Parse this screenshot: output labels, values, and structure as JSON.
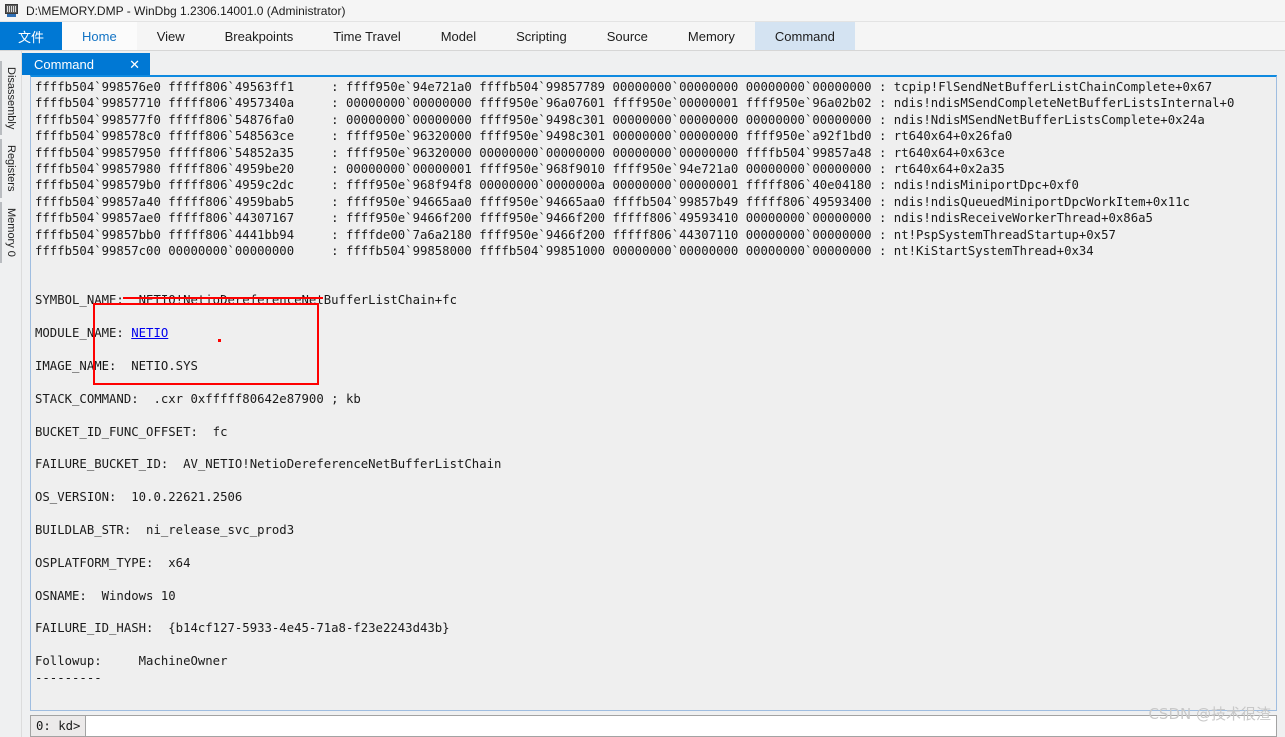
{
  "window": {
    "title": "D:\\MEMORY.DMP - WinDbg 1.2306.14001.0 (Administrator)",
    "icon": "windbg-app-icon"
  },
  "ribbon": {
    "file_label": "文件",
    "tabs": [
      {
        "label": "Home",
        "state": "home"
      },
      {
        "label": "View",
        "state": "normal"
      },
      {
        "label": "Breakpoints",
        "state": "normal"
      },
      {
        "label": "Time Travel",
        "state": "normal"
      },
      {
        "label": "Model",
        "state": "normal"
      },
      {
        "label": "Scripting",
        "state": "normal"
      },
      {
        "label": "Source",
        "state": "normal"
      },
      {
        "label": "Memory",
        "state": "normal"
      },
      {
        "label": "Command",
        "state": "active"
      }
    ]
  },
  "sidebar": {
    "items": [
      {
        "label": "Disassembly"
      },
      {
        "label": "Registers"
      },
      {
        "label": "Memory 0"
      }
    ]
  },
  "document_tab": {
    "label": "Command",
    "close_glyph": "✕"
  },
  "output": {
    "text": "ffffb504`998576e0 fffff806`49563ff1     : ffff950e`94e721a0 ffffb504`99857789 00000000`00000000 00000000`00000000 : tcpip!FlSendNetBufferListChainComplete+0x67\nffffb504`99857710 fffff806`4957340a     : 00000000`00000000 ffff950e`96a07601 ffff950e`00000001 ffff950e`96a02b02 : ndis!ndisMSendCompleteNetBufferListsInternal+0\nffffb504`998577f0 fffff806`54876fa0     : 00000000`00000000 ffff950e`9498c301 00000000`00000000 00000000`00000000 : ndis!NdisMSendNetBufferListsComplete+0x24a\nffffb504`998578c0 fffff806`548563ce     : ffff950e`96320000 ffff950e`9498c301 00000000`00000000 ffff950e`a92f1bd0 : rt640x64+0x26fa0\nffffb504`99857950 fffff806`54852a35     : ffff950e`96320000 00000000`00000000 00000000`00000000 ffffb504`99857a48 : rt640x64+0x63ce\nffffb504`99857980 fffff806`4959be20     : 00000000`00000001 ffff950e`968f9010 ffff950e`94e721a0 00000000`00000000 : rt640x64+0x2a35\nffffb504`998579b0 fffff806`4959c2dc     : ffff950e`968f94f8 00000000`0000000a 00000000`00000001 fffff806`40e04180 : ndis!ndisMiniportDpc+0xf0\nffffb504`99857a40 fffff806`4959bab5     : ffff950e`94665aa0 ffff950e`94665aa0 ffffb504`99857b49 fffff806`49593400 : ndis!ndisQueuedMiniportDpcWorkItem+0x11c\nffffb504`99857ae0 fffff806`44307167     : ffff950e`9466f200 ffff950e`9466f200 fffff806`49593410 00000000`00000000 : ndis!ndisReceiveWorkerThread+0x86a5\nffffb504`99857bb0 fffff806`4441bb94     : ffffde00`7a6a2180 ffff950e`9466f200 fffff806`44307110 00000000`00000000 : nt!PspSystemThreadStartup+0x57\nffffb504`99857c00 00000000`00000000     : ffffb504`99858000 ffffb504`99851000 00000000`00000000 00000000`00000000 : nt!KiStartSystemThread+0x34\n\n\n",
    "lines_after_link": {
      "symbol_name": "SYMBOL_NAME:  NETIO!NetioDereferenceNetBufferListChain+fc",
      "module_name_label": "MODULE_NAME: ",
      "module_name_link": "NETIO",
      "image_name": "IMAGE_NAME:  NETIO.SYS",
      "stack_command": "STACK_COMMAND:  .cxr 0xfffff80642e87900 ; kb",
      "bucket_id_func_offset": "BUCKET_ID_FUNC_OFFSET:  fc",
      "failure_bucket_id": "FAILURE_BUCKET_ID:  AV_NETIO!NetioDereferenceNetBufferListChain",
      "os_version": "OS_VERSION:  10.0.22621.2506",
      "buildlab_str": "BUILDLAB_STR:  ni_release_svc_prod3",
      "osplatform_type": "OSPLATFORM_TYPE:  x64",
      "osname": "OSNAME:  Windows 10",
      "failure_id_hash": "FAILURE_ID_HASH:  {b14cf127-5933-4e45-71a8-f23e2243d43b}",
      "followup": "Followup:     MachineOwner",
      "followup_rule": "---------"
    }
  },
  "prompt": {
    "label": "0: kd>",
    "value": "",
    "placeholder": ""
  },
  "annotation": {
    "color": "#fe0000",
    "shape": "rectangle-highlight"
  },
  "watermark": {
    "text": "CSDN @技术很渣"
  }
}
